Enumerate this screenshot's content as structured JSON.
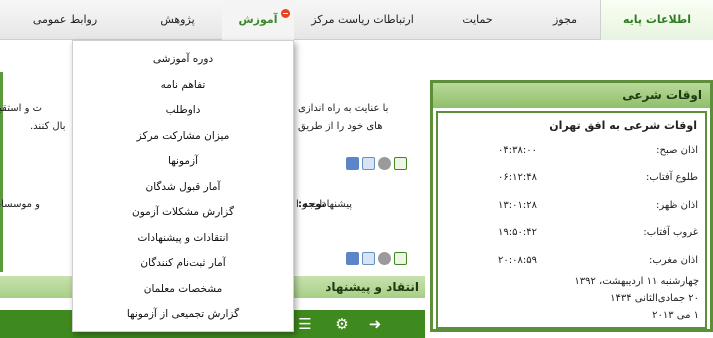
{
  "nav": {
    "items": [
      {
        "label": "اطلاعات پایه"
      },
      {
        "label": "مجوز"
      },
      {
        "label": "حمایت"
      },
      {
        "label": "ارتباطات ریاست مرکز"
      },
      {
        "label": "آموزش"
      },
      {
        "label": "پژوهش"
      },
      {
        "label": "روابط عمومی"
      }
    ]
  },
  "dropdown": {
    "items": [
      "دوره آموزشی",
      "تفاهم نامه",
      "داوطلب",
      "میزان مشارکت مرکز",
      "آزمونها",
      "آمار قبول شدگان",
      "گزارش مشکلات آزمون",
      "انتقادات و پیشنهادات",
      "آمار ثبت‌نام کنندگان",
      "مشخصات معلمان",
      "گزارش تجمیعی از آزمونها"
    ]
  },
  "article": {
    "line1": "با عنایت به راه اندازی",
    "line1b": "ت و استقبال خو",
    "line2": "های خود را از طریق",
    "line2b": "بال کنند.",
    "note_label": "توجه:",
    "note_text": "پیشنهادات و ا",
    "note_tail": "و موسسات قر"
  },
  "prayer": {
    "title": "اوقات شرعی",
    "heading": "اوقات شرعی به افق تهران",
    "times": [
      {
        "name": "اذان صبح:",
        "time": "۰۴:۳۸:۰۰"
      },
      {
        "name": "طلوع آفتاب:",
        "time": "۰۶:۱۲:۴۸"
      },
      {
        "name": "اذان ظهر:",
        "time": "۱۳:۰۱:۲۸"
      },
      {
        "name": "غروب آفتاب:",
        "time": "۱۹:۵۰:۴۲"
      },
      {
        "name": "اذان مغرب:",
        "time": "۲۰:۰۸:۵۹"
      }
    ],
    "date_solar": "چهارشنبه ۱۱ اردیبهشت، ۱۳۹۲",
    "date_lunar": "۲۰ جمادی‌الثانی ۱۴۳۴",
    "date_greg": "۱ می ۲۰۱۳"
  },
  "critique": {
    "title": "انتقاد و پیشنهاد"
  },
  "colors": {
    "accent": "#3f8a1e",
    "title_green": "#a7cf86",
    "close": "#e8431c"
  }
}
